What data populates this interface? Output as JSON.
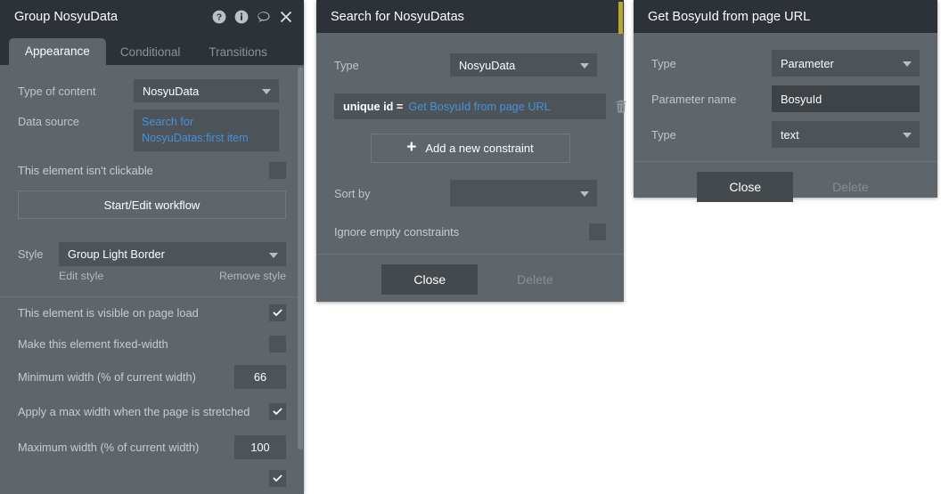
{
  "panel1": {
    "title": "Group NosyuData",
    "header_icons": [
      "help-icon",
      "info-icon",
      "comment-icon",
      "close-icon"
    ],
    "tabs": [
      {
        "label": "Appearance",
        "active": true
      },
      {
        "label": "Conditional",
        "active": false
      },
      {
        "label": "Transitions",
        "active": false
      }
    ],
    "type_of_content_label": "Type of content",
    "type_of_content_value": "NosyuData",
    "data_source_label": "Data source",
    "data_source_value": "Search for NosyuDatas:first item",
    "not_clickable_label": "This element isn't clickable",
    "not_clickable_checked": false,
    "workflow_button": "Start/Edit workflow",
    "style_label": "Style",
    "style_value": "Group Light Border",
    "edit_style_link": "Edit style",
    "remove_style_link": "Remove style",
    "options": [
      {
        "label": "This element is visible on page load",
        "type": "checkbox",
        "checked": true
      },
      {
        "label": "Make this element fixed-width",
        "type": "checkbox",
        "checked": false
      },
      {
        "label": "Minimum width (% of current width)",
        "type": "number",
        "value": "66"
      },
      {
        "label": "Apply a max width when the page is stretched",
        "type": "checkbox",
        "checked": true
      },
      {
        "label": "Maximum width (% of current width)",
        "type": "number",
        "value": "100"
      }
    ]
  },
  "panel2": {
    "title": "Search for NosyuDatas",
    "type_label": "Type",
    "type_value": "NosyuData",
    "constraint": {
      "key": "unique id =",
      "value": "Get BosyuId from page URL",
      "delete_icon": "trash-icon"
    },
    "add_constraint_button": "Add a new constraint",
    "sort_by_label": "Sort by",
    "sort_by_value": "",
    "ignore_empty_label": "Ignore empty constraints",
    "ignore_empty_checked": false,
    "close_button": "Close",
    "delete_button": "Delete"
  },
  "panel3": {
    "title": "Get BosyuId from page URL",
    "type_label": "Type",
    "type_value": "Parameter",
    "parameter_name_label": "Parameter name",
    "parameter_name_value": "BosyuId",
    "value_type_label": "Type",
    "value_type_value": "text",
    "close_button": "Close",
    "delete_button": "Delete"
  },
  "colors": {
    "panel_bg": "#5f666b",
    "header_bg": "#2d3238",
    "field_bg": "#4c5359",
    "link_blue": "#4a90d9",
    "accent_yellow": "#b7a832"
  }
}
